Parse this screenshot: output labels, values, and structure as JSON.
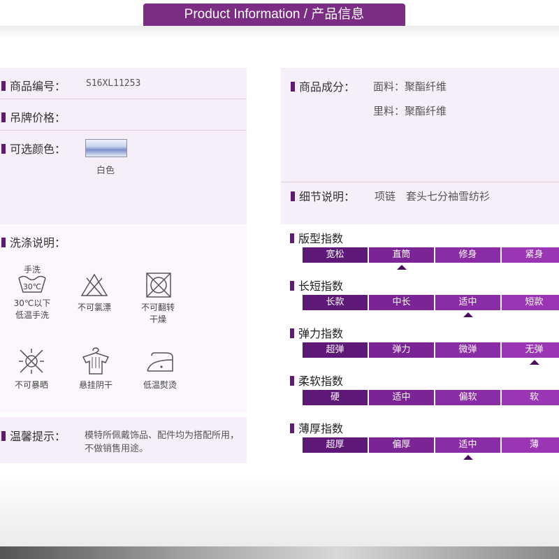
{
  "header": {
    "title": "Product Information / 产品信息"
  },
  "left": {
    "item_no": {
      "label": "商品编号：",
      "value": "S16XL11253"
    },
    "tag_price": {
      "label": "吊牌价格："
    },
    "colors": {
      "label": "可选颜色：",
      "swatch_label": "白色"
    },
    "wash": {
      "label": "洗涤说明："
    },
    "care": [
      {
        "icon": "hand-wash-icon",
        "top": "手洗",
        "mid": "30℃",
        "text1": "30℃以下",
        "text2": "低温手洗"
      },
      {
        "icon": "no-bleach-icon",
        "text1": "不可氯漂",
        "text2": ""
      },
      {
        "icon": "no-tumble-dry-icon",
        "text1": "不可翻转",
        "text2": "干燥"
      },
      {
        "icon": "no-sun-dry-icon",
        "text1": "不可暴晒",
        "text2": ""
      },
      {
        "icon": "hang-dry-icon",
        "text1": "悬挂阴干",
        "text2": ""
      },
      {
        "icon": "low-iron-icon",
        "text1": "低温熨烫",
        "text2": ""
      }
    ],
    "tips": {
      "label": "温馨提示：",
      "line1": "模特所佩戴饰品、配件均为搭配所用，",
      "line2": "不做销售用途。"
    }
  },
  "right": {
    "composition": {
      "label": "商品成分：",
      "outer": "面料：聚酯纤维",
      "lining": "里料：聚酯纤维"
    },
    "detail": {
      "label": "细节说明：",
      "value": "项链　套头七分袖雪纺衫"
    },
    "indices": [
      {
        "title": "版型指数",
        "options": [
          "宽松",
          "直筒",
          "修身",
          "紧身"
        ],
        "selected": 1
      },
      {
        "title": "长短指数",
        "options": [
          "长款",
          "中长",
          "适中",
          "短款"
        ],
        "selected": 2
      },
      {
        "title": "弹力指数",
        "options": [
          "超弹",
          "弹力",
          "微弹",
          "无弹"
        ],
        "selected": 3
      },
      {
        "title": "柔软指数",
        "options": [
          "硬",
          "适中",
          "偏软",
          "软"
        ],
        "selected": null
      },
      {
        "title": "薄厚指数",
        "options": [
          "超厚",
          "偏厚",
          "适中",
          "薄"
        ],
        "selected": 2
      }
    ]
  },
  "colors": {
    "brand_purple": "#7a2d82",
    "panel_bg": "#f6eef9"
  }
}
